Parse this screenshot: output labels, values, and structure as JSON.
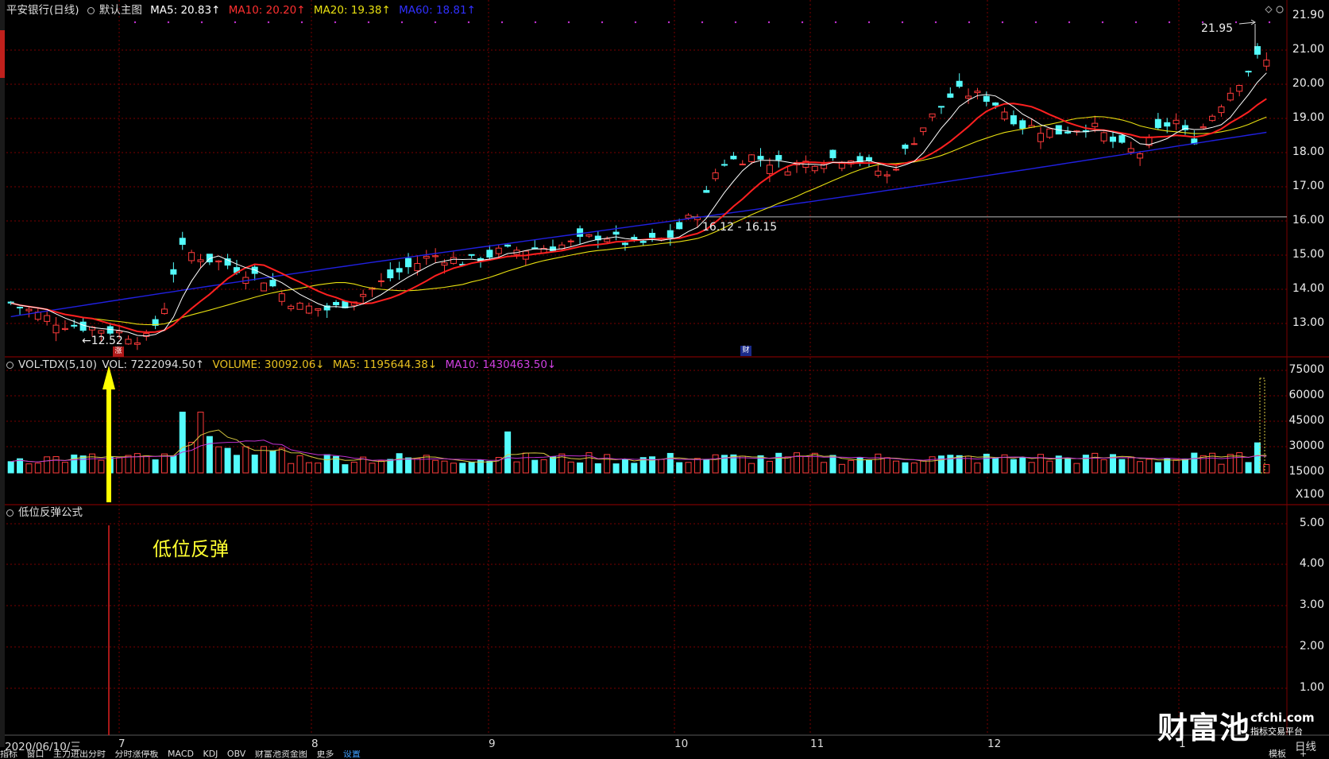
{
  "price_header": {
    "title": "平安银行(日线)",
    "chart_name": "默认主图",
    "ma5": "MA5: 20.83↑",
    "ma10": "MA10: 20.20↑",
    "ma20": "MA20: 19.38↑",
    "ma60": "MA60: 18.81↑"
  },
  "volume_header": {
    "name": "VOL-TDX(5,10)",
    "vol": "VOL: 7222094.50↑",
    "volume": "VOLUME: 30092.06↓",
    "ma5": "MA5: 1195644.38↓",
    "ma10": "MA10: 1430463.50↓"
  },
  "indicator_header": {
    "name": "低位反弹公式"
  },
  "annotations": {
    "low_label": "←12.52",
    "high_label": "21.95",
    "level_label": "16.12 - 16.15",
    "rebound_text": "低位反弹",
    "zhang_badge": "涨",
    "cai_badge": "财"
  },
  "price_axis": [
    "21.90",
    "21.00",
    "20.00",
    "19.00",
    "18.00",
    "17.00",
    "16.00",
    "15.00",
    "14.00",
    "13.00"
  ],
  "volume_axis": [
    "75000",
    "60000",
    "45000",
    "30000",
    "15000",
    "X100"
  ],
  "indicator_axis": [
    "5.00",
    "4.00",
    "3.00",
    "2.00",
    "1.00"
  ],
  "dates": {
    "current": "2020/06/10/三",
    "months": [
      "7",
      "8",
      "9",
      "10",
      "11",
      "12",
      "1"
    ]
  },
  "period_label": "日线",
  "bottom_tabs": [
    "指标",
    "窗口",
    "主力进出分时",
    "分时涨停板",
    "MACD",
    "KDJ",
    "OBV",
    "财富池资金图",
    "更多",
    "设置"
  ],
  "bottom_right": [
    "模板",
    "+"
  ],
  "watermark": {
    "brand": "财富池",
    "site": "cfchi.com",
    "slogan": "指标交易平台"
  },
  "colors": {
    "up": "#ff3b3b",
    "down": "#54fcfc",
    "ma5": "#ffffff",
    "ma10": "#ff2020",
    "ma20": "#e8e010",
    "ma60": "#2020e0",
    "vol_ma5": "#d8c840",
    "vol_ma10": "#c030d0",
    "grid": "#7a0000",
    "arrow": "#ffff00"
  }
}
